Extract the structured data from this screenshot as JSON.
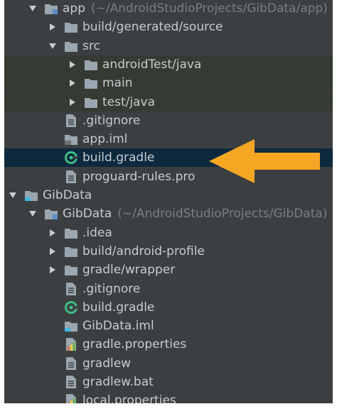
{
  "tree": [
    {
      "level": 1,
      "arrow": "expanded",
      "icon": "module-folder-icon",
      "label": "app",
      "path": "(~/AndroidStudioProjects/GibData/app)"
    },
    {
      "level": 2,
      "arrow": "collapsed",
      "icon": "folder-icon",
      "label": "build/generated/source",
      "path": ""
    },
    {
      "level": 2,
      "arrow": "expanded",
      "icon": "folder-icon",
      "label": "src",
      "path": ""
    },
    {
      "level": 3,
      "arrow": "collapsed",
      "icon": "folder-icon",
      "label": "androidTest/java",
      "path": ""
    },
    {
      "level": 3,
      "arrow": "collapsed",
      "icon": "folder-icon",
      "label": "main",
      "path": ""
    },
    {
      "level": 3,
      "arrow": "collapsed",
      "icon": "folder-icon",
      "label": "test/java",
      "path": ""
    },
    {
      "level": 2,
      "arrow": "none",
      "icon": "text-file-icon",
      "label": ".gitignore",
      "path": ""
    },
    {
      "level": 2,
      "arrow": "none",
      "icon": "iml-file-icon",
      "label": "app.iml",
      "path": ""
    },
    {
      "level": 2,
      "arrow": "none",
      "icon": "gradle-icon",
      "label": "build.gradle",
      "path": "",
      "selected": true
    },
    {
      "level": 2,
      "arrow": "none",
      "icon": "text-file-icon",
      "label": "proguard-rules.pro",
      "path": ""
    },
    {
      "level": 0,
      "arrow": "expanded",
      "icon": "project-icon",
      "label": "GibData",
      "path": ""
    },
    {
      "level": 1,
      "arrow": "expanded",
      "icon": "module-folder-icon",
      "label": "GibData",
      "path": "(~/AndroidStudioProjects/GibData)"
    },
    {
      "level": 2,
      "arrow": "collapsed",
      "icon": "folder-icon",
      "label": ".idea",
      "path": ""
    },
    {
      "level": 2,
      "arrow": "collapsed",
      "icon": "folder-icon",
      "label": "build/android-profile",
      "path": ""
    },
    {
      "level": 2,
      "arrow": "collapsed",
      "icon": "folder-icon",
      "label": "gradle/wrapper",
      "path": ""
    },
    {
      "level": 2,
      "arrow": "none",
      "icon": "text-file-icon",
      "label": ".gitignore",
      "path": ""
    },
    {
      "level": 2,
      "arrow": "none",
      "icon": "gradle-icon",
      "label": "build.gradle",
      "path": ""
    },
    {
      "level": 2,
      "arrow": "none",
      "icon": "project-iml-icon",
      "label": "GibData.iml",
      "path": ""
    },
    {
      "level": 2,
      "arrow": "none",
      "icon": "properties-file-icon",
      "label": "gradle.properties",
      "path": ""
    },
    {
      "level": 2,
      "arrow": "none",
      "icon": "text-file-icon",
      "label": "gradlew",
      "path": ""
    },
    {
      "level": 2,
      "arrow": "none",
      "icon": "text-file-icon",
      "label": "gradlew.bat",
      "path": ""
    },
    {
      "level": 2,
      "arrow": "none",
      "icon": "properties-file-icon",
      "label": "local.properties",
      "path": ""
    }
  ],
  "colors": {
    "background": "#3c3f41",
    "selected_row": "#0d293e",
    "text": "#c9ccce",
    "path_text": "#7b7f82",
    "pointer_arrow": "#f5a623",
    "gradle_green": "#3fbf83"
  }
}
